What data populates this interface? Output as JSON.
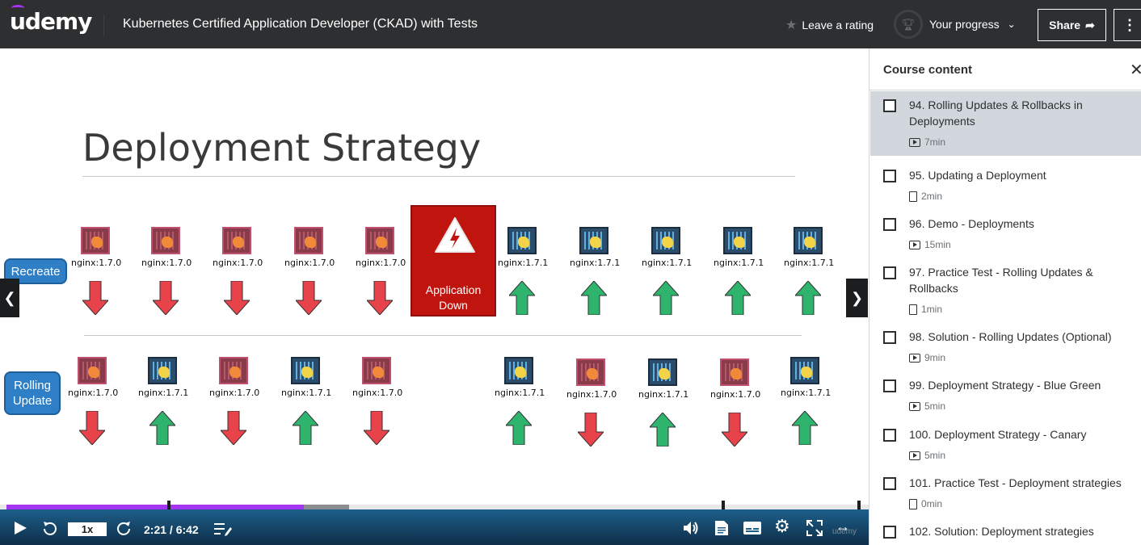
{
  "header": {
    "logo": "udemy",
    "course_title": "Kubernetes Certified Application Developer (CKAD) with Tests",
    "rating_label": "Leave a rating",
    "progress_label": "Your progress",
    "share_label": "Share"
  },
  "slide": {
    "title": "Deployment Strategy",
    "recreate_label": "Recreate",
    "rolling_label_1": "Rolling",
    "rolling_label_2": "Update",
    "app_down_1": "Application",
    "app_down_2": "Down",
    "old_image": "nginx:1.7.0",
    "new_image": "nginx:1.7.1",
    "recreate_row": [
      "nginx:1.7.0",
      "nginx:1.7.0",
      "nginx:1.7.0",
      "nginx:1.7.0",
      "nginx:1.7.0",
      "nginx:1.7.1",
      "nginx:1.7.1",
      "nginx:1.7.1",
      "nginx:1.7.1",
      "nginx:1.7.1"
    ],
    "rolling_row": [
      "nginx:1.7.0",
      "nginx:1.7.1",
      "nginx:1.7.0",
      "nginx:1.7.1",
      "nginx:1.7.0",
      "nginx:1.7.1",
      "nginx:1.7.0",
      "nginx:1.7.1",
      "nginx:1.7.0",
      "nginx:1.7.1"
    ]
  },
  "player": {
    "speed": "1x",
    "time": "2:21 / 6:42",
    "progress_fraction": 0.351,
    "watermark": "udemy"
  },
  "sidebar": {
    "title": "Course content",
    "items": [
      {
        "title": "94. Rolling Updates & Rollbacks in Deployments",
        "meta": "7min",
        "type": "video",
        "active": true
      },
      {
        "title": "95. Updating a Deployment",
        "meta": "2min",
        "type": "doc",
        "active": false
      },
      {
        "title": "96. Demo - Deployments",
        "meta": "15min",
        "type": "video",
        "active": false
      },
      {
        "title": "97. Practice Test - Rolling Updates & Rollbacks",
        "meta": "1min",
        "type": "doc",
        "active": false
      },
      {
        "title": "98. Solution - Rolling Updates (Optional)",
        "meta": "9min",
        "type": "video",
        "active": false
      },
      {
        "title": "99. Deployment Strategy - Blue Green",
        "meta": "5min",
        "type": "video",
        "active": false
      },
      {
        "title": "100. Deployment Strategy - Canary",
        "meta": "5min",
        "type": "video",
        "active": false
      },
      {
        "title": "101. Practice Test - Deployment strategies",
        "meta": "0min",
        "type": "doc",
        "active": false
      },
      {
        "title": "102. Solution: Deployment strategies",
        "meta": "",
        "type": "video",
        "active": false
      }
    ]
  },
  "colors": {
    "accent": "#a435f0",
    "header_bg": "#2d2f31",
    "app_down": "#c0140f",
    "arrow_down": "#e8424a",
    "arrow_up": "#2fb46e"
  }
}
